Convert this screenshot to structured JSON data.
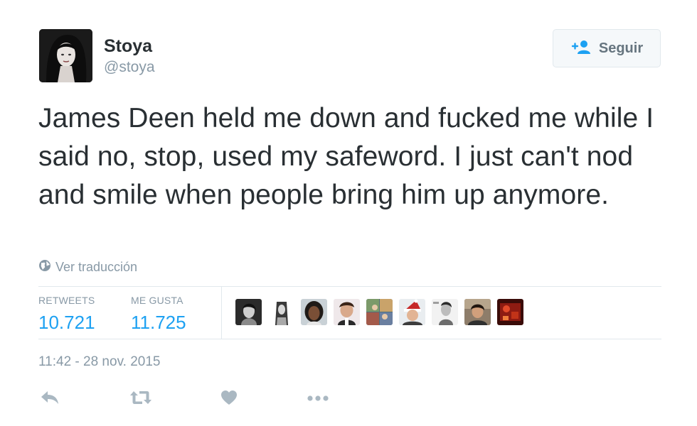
{
  "author": {
    "name": "Stoya",
    "handle": "@stoya"
  },
  "follow_button": {
    "label": "Seguir",
    "icon": "follow-person-plus-icon"
  },
  "tweet": {
    "text": "James Deen held me down and fucked me while I said no, stop, used my safeword. I just can't nod and smile when people bring him up anymore.",
    "translate_label": "Ver traducción",
    "translate_icon": "globe-icon",
    "timestamp": "11:42 - 28 nov. 2015"
  },
  "stats": {
    "retweets_label": "RETWEETS",
    "retweets_value": "10.721",
    "likes_label": "ME GUSTA",
    "likes_value": "11.725"
  },
  "facepile_count": 9,
  "actions": [
    {
      "name": "reply",
      "icon": "reply-icon"
    },
    {
      "name": "retweet",
      "icon": "retweet-icon"
    },
    {
      "name": "like",
      "icon": "heart-icon"
    },
    {
      "name": "more",
      "icon": "more-dots-icon"
    }
  ],
  "colors": {
    "text": "#292f33",
    "secondary": "#8899a6",
    "link_blue": "#1da1f2",
    "border": "#e1e8ed",
    "icon_gray": "#aab8c2"
  }
}
